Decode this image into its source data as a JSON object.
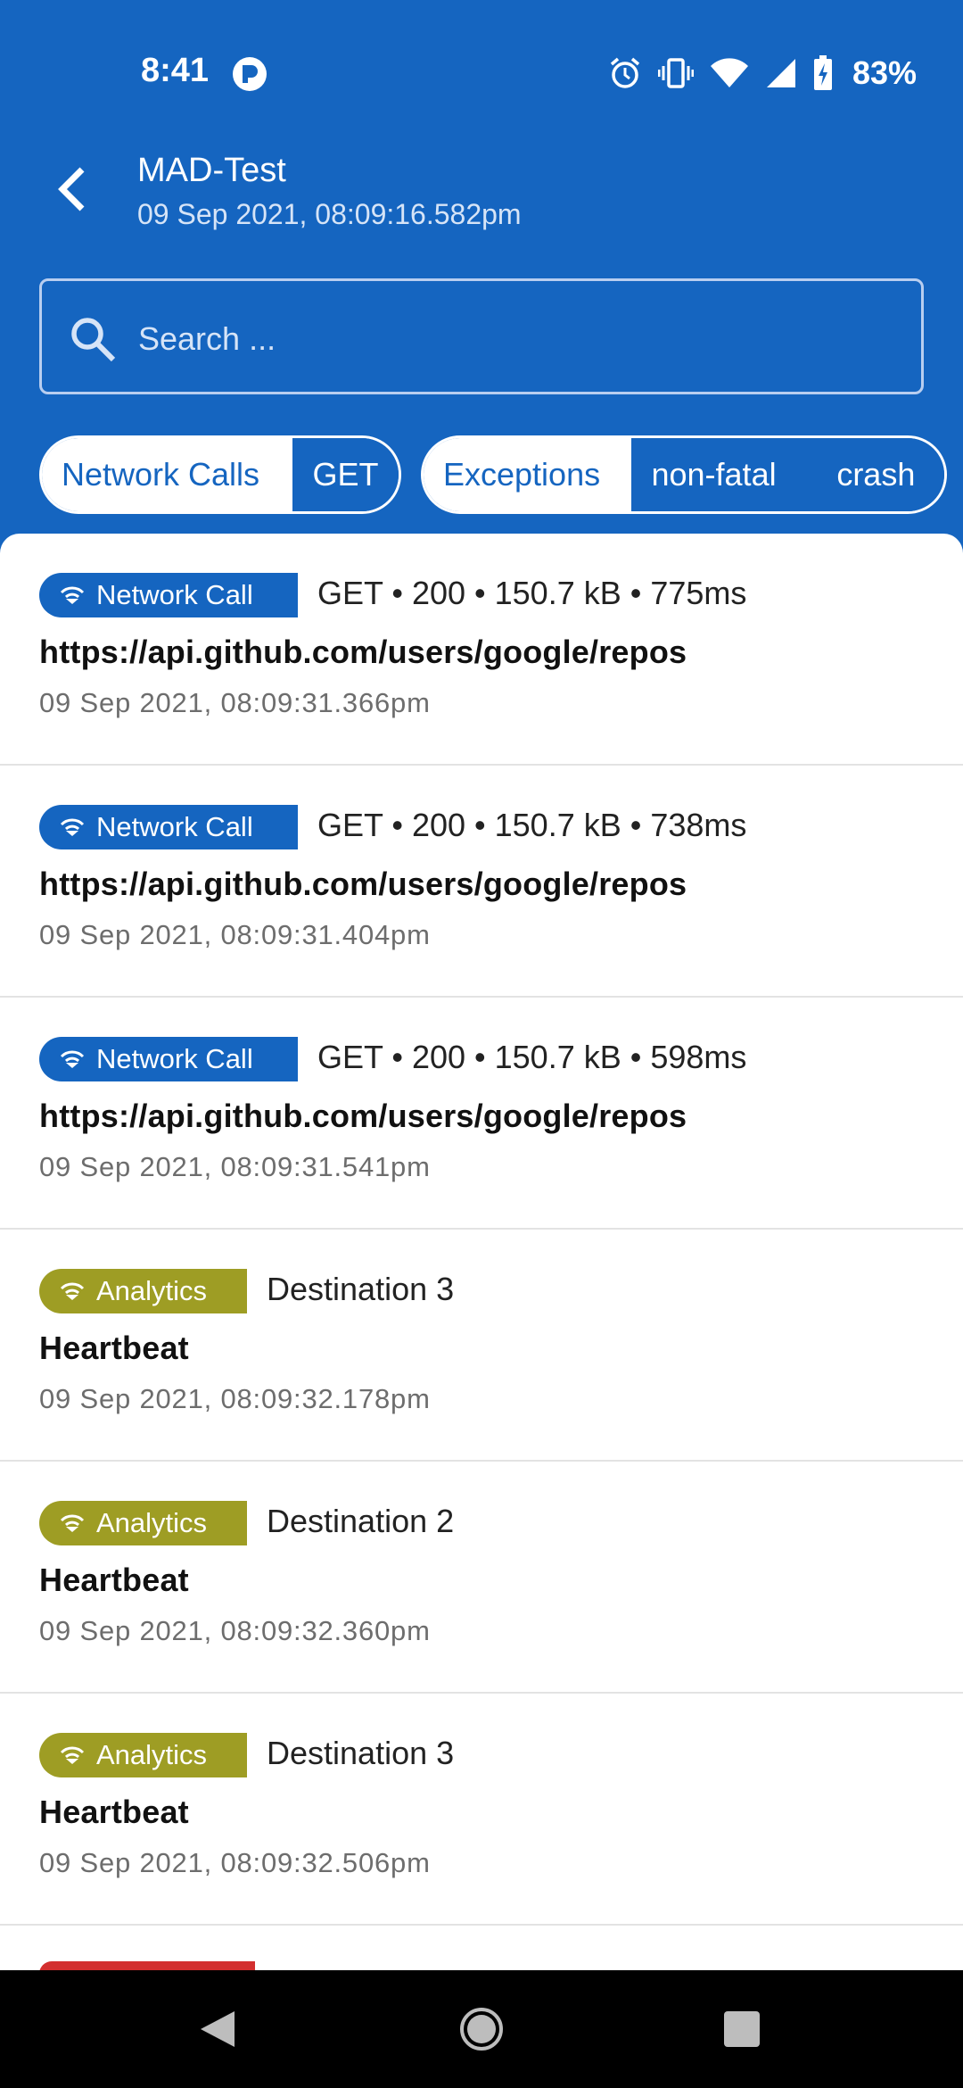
{
  "status_bar": {
    "time": "8:41",
    "battery": "83%",
    "icons": [
      "app-notification-icon",
      "alarm-icon",
      "vibrate-icon",
      "wifi-icon",
      "cell-signal-icon",
      "battery-charging-icon"
    ]
  },
  "header": {
    "title": "MAD-Test",
    "subtitle": "09 Sep 2021, 08:09:16.582pm"
  },
  "search": {
    "placeholder": "Search ..."
  },
  "filters": {
    "network": [
      "Network Calls",
      "GET"
    ],
    "exceptions": [
      "Exceptions",
      "non-fatal",
      "crash"
    ]
  },
  "list": {
    "items": [
      {
        "badge": "Network Call",
        "meta": "GET • 200 • 150.7 kB • 775ms",
        "title": "https://api.github.com/users/google/repos",
        "time": "09 Sep 2021, 08:09:31.366pm"
      },
      {
        "badge": "Network Call",
        "meta": "GET • 200 • 150.7 kB • 738ms",
        "title": "https://api.github.com/users/google/repos",
        "time": "09 Sep 2021, 08:09:31.404pm"
      },
      {
        "badge": "Network Call",
        "meta": "GET • 200 • 150.7 kB • 598ms",
        "title": "https://api.github.com/users/google/repos",
        "time": "09 Sep 2021, 08:09:31.541pm"
      },
      {
        "badge": "Analytics",
        "meta": "Destination 3",
        "title": "Heartbeat",
        "time": "09 Sep 2021, 08:09:32.178pm"
      },
      {
        "badge": "Analytics",
        "meta": "Destination 2",
        "title": "Heartbeat",
        "time": "09 Sep 2021, 08:09:32.360pm"
      },
      {
        "badge": "Analytics",
        "meta": "Destination 3",
        "title": "Heartbeat",
        "time": "09 Sep 2021, 08:09:32.506pm"
      }
    ]
  },
  "colors": {
    "primary": "#1565C0",
    "analytics": "#9E9D24",
    "crash": "#D32F2F"
  },
  "nav_bar": {
    "icons": [
      "back-triangle-icon",
      "home-circle-icon",
      "recents-square-icon"
    ]
  }
}
